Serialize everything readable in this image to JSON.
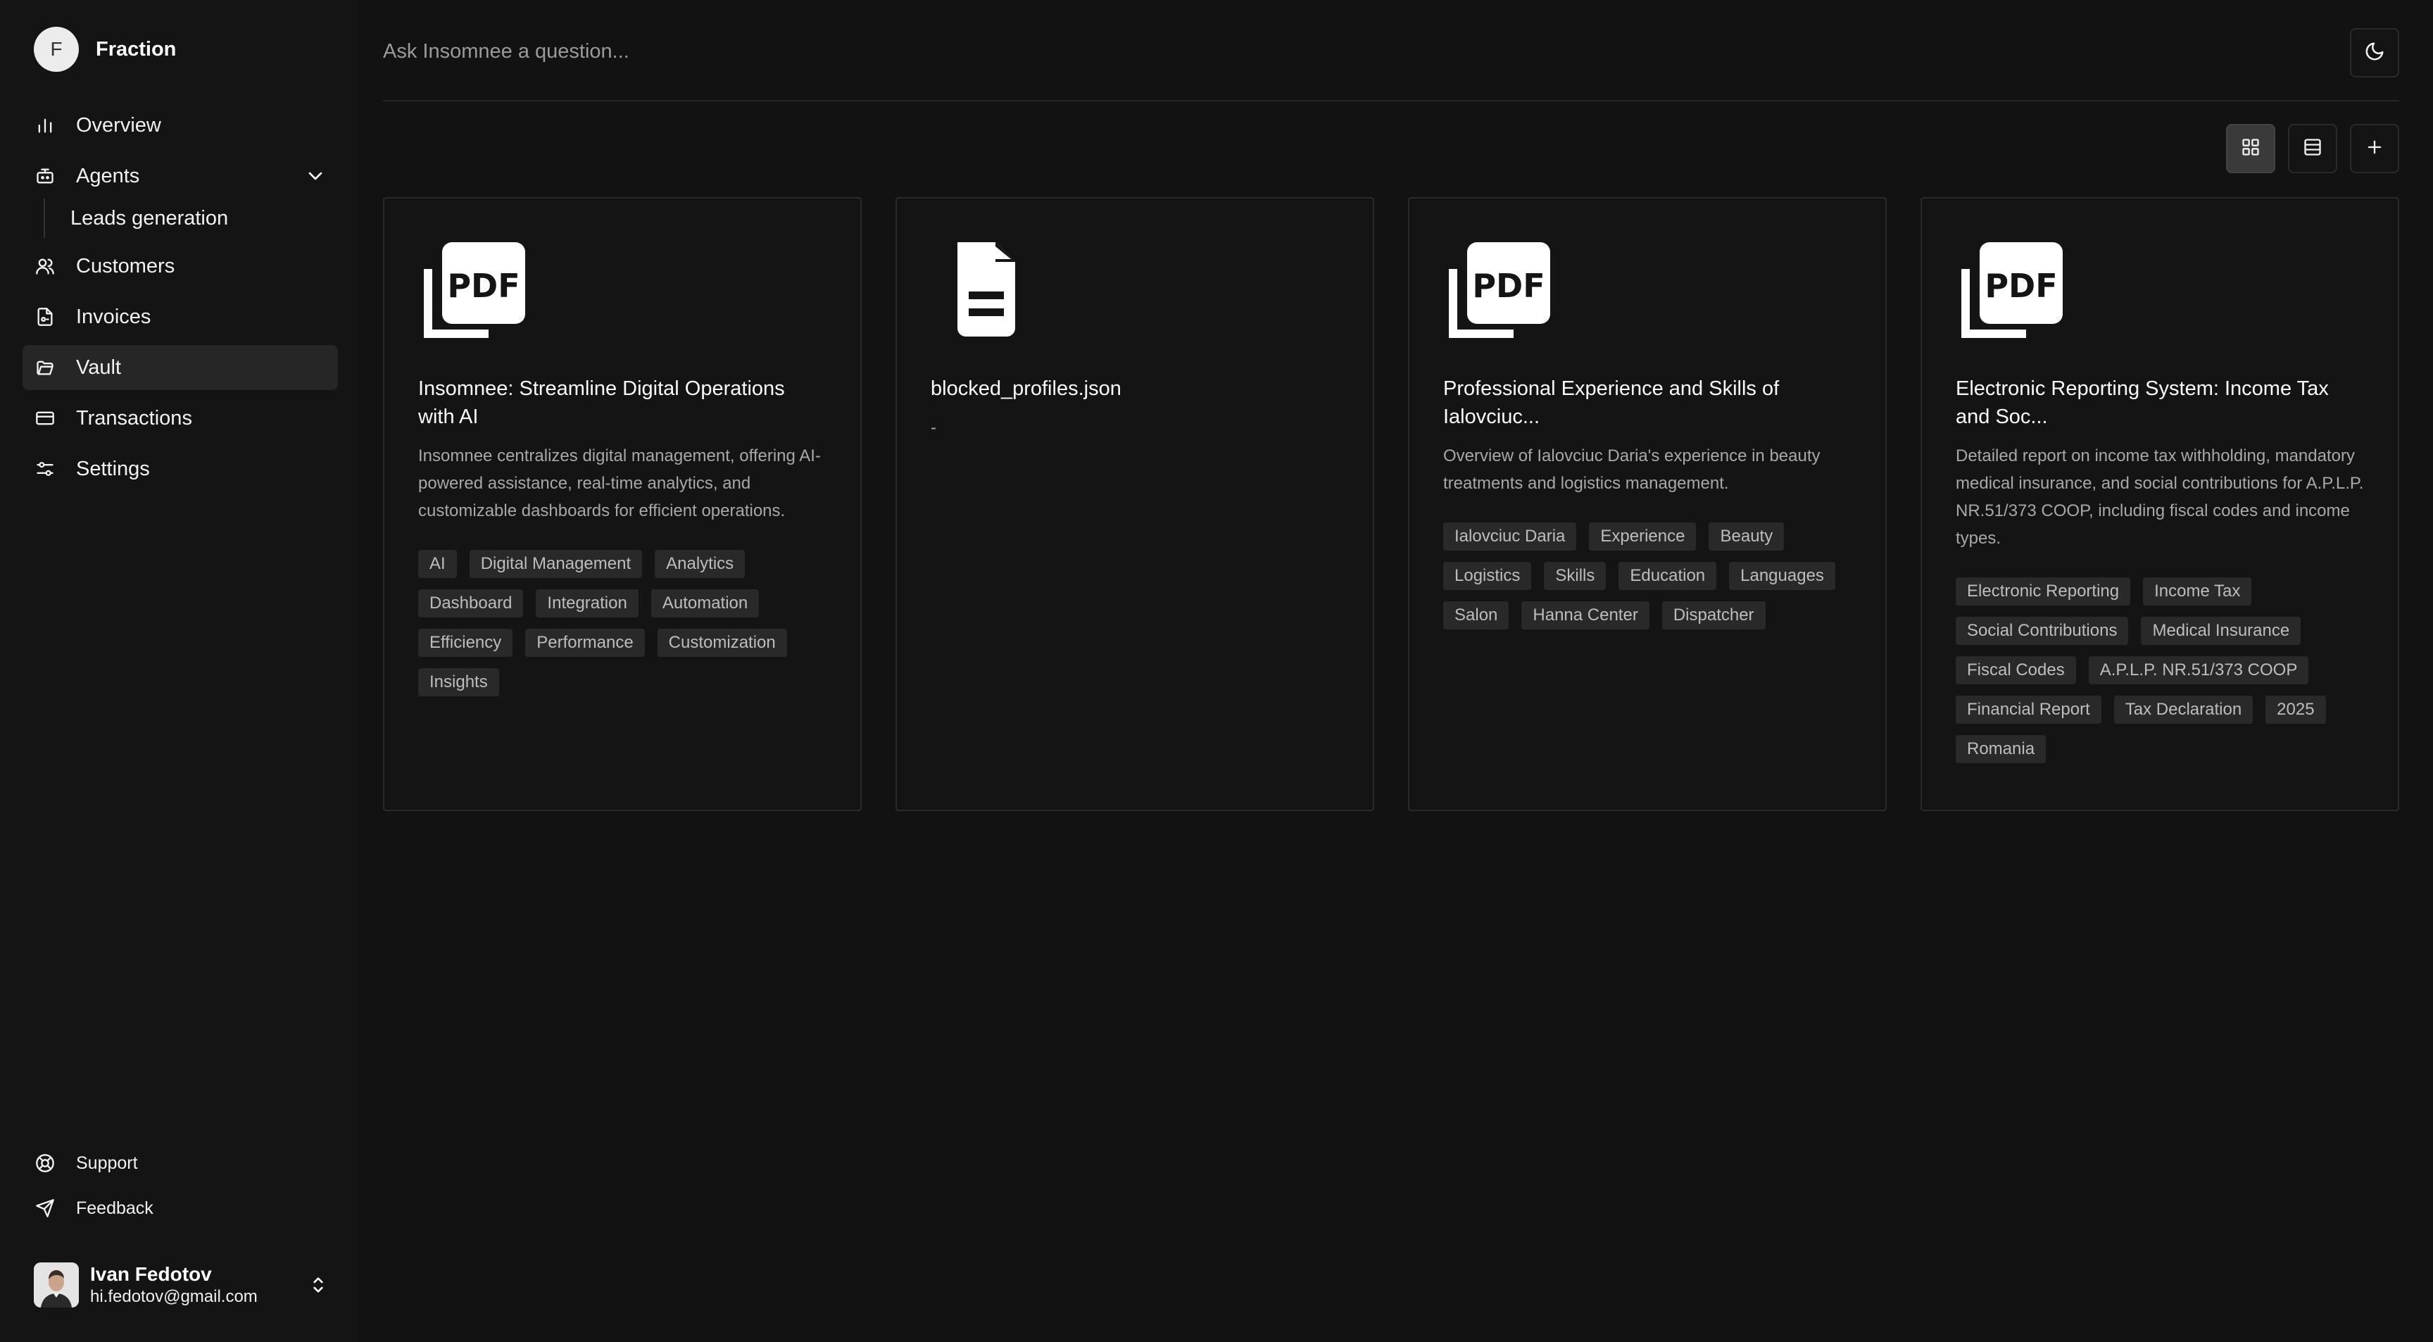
{
  "brand": {
    "initial": "F",
    "name": "Fraction"
  },
  "nav": {
    "overview": "Overview",
    "agents": "Agents",
    "leads_generation": "Leads generation",
    "customers": "Customers",
    "invoices": "Invoices",
    "vault": "Vault",
    "transactions": "Transactions",
    "settings": "Settings",
    "support": "Support",
    "feedback": "Feedback"
  },
  "user": {
    "name": "Ivan Fedotov",
    "email": "hi.fedotov@gmail.com"
  },
  "search": {
    "placeholder": "Ask Insomnee a question..."
  },
  "cards": [
    {
      "icon": "pdf-file-icon",
      "title": "Insomnee: Streamline Digital Operations with AI",
      "description": "Insomnee centralizes digital management, offering AI-powered assistance, real-time analytics, and customizable dashboards for efficient operations.",
      "tags": [
        "AI",
        "Digital Management",
        "Analytics",
        "Dashboard",
        "Integration",
        "Automation",
        "Efficiency",
        "Performance",
        "Customization",
        "Insights"
      ]
    },
    {
      "icon": "document-file-icon",
      "title": "blocked_profiles.json",
      "description": "-",
      "tags": []
    },
    {
      "icon": "pdf-file-icon",
      "title": "Professional Experience and Skills of Ialovciuc...",
      "description": "Overview of Ialovciuc Daria's experience in beauty treatments and logistics management.",
      "tags": [
        "Ialovciuc Daria",
        "Experience",
        "Beauty",
        "Logistics",
        "Skills",
        "Education",
        "Languages",
        "Salon",
        "Hanna Center",
        "Dispatcher"
      ]
    },
    {
      "icon": "pdf-file-icon",
      "title": "Electronic Reporting System: Income Tax and Soc...",
      "description": "Detailed report on income tax withholding, mandatory medical insurance, and social contributions for A.P.L.P. NR.51/373 COOP, including fiscal codes and income types.",
      "tags": [
        "Electronic Reporting",
        "Income Tax",
        "Social Contributions",
        "Medical Insurance",
        "Fiscal Codes",
        "A.P.L.P. NR.51/373 COOP",
        "Financial Report",
        "Tax Declaration",
        "2025",
        "Romania"
      ]
    }
  ]
}
